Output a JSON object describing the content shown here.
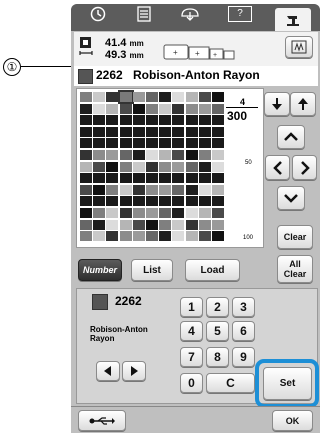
{
  "callout": {
    "number": "①"
  },
  "toolbar": {
    "icons": [
      "clock-icon",
      "document-icon",
      "design-icon",
      "help-icon",
      "sewing-machine-icon"
    ],
    "help_label": "?"
  },
  "size": {
    "width": "41.4",
    "height": "49.3",
    "unit": "mm"
  },
  "current_thread": {
    "number": "2262",
    "name": "Robison-Anton Rayon",
    "color": "#555555"
  },
  "page": {
    "current": "4",
    "total": "300"
  },
  "grid_marks": {
    "mark_50": "50",
    "mark_100": "100"
  },
  "buttons": {
    "clear": "Clear",
    "all_clear_1": "All",
    "all_clear_2": "Clear",
    "number": "Number",
    "list": "List",
    "load": "Load",
    "set": "Set",
    "ok": "OK",
    "c": "C"
  },
  "entry": {
    "number": "2262",
    "name_line1": "Robison-Anton",
    "name_line2": "Rayon"
  },
  "keypad": [
    "1",
    "2",
    "3",
    "4",
    "5",
    "6",
    "7",
    "8",
    "9",
    "0"
  ],
  "highlight_color": "#1d8fd6"
}
